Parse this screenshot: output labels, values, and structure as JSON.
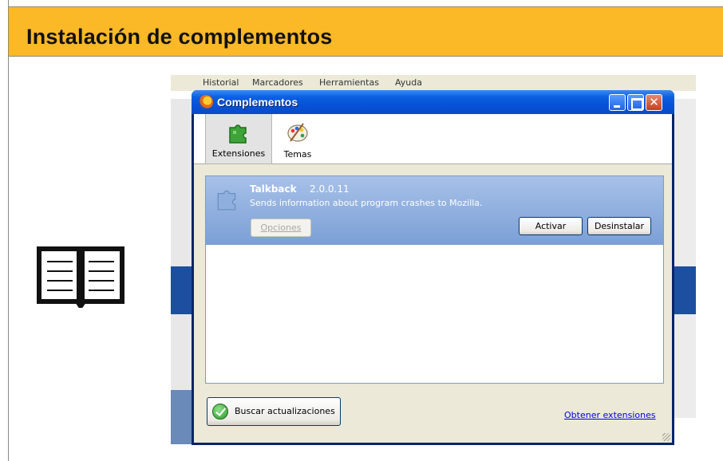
{
  "slide": {
    "title": "Instalación de complementos",
    "accent_color": "#fbb827",
    "icon": "open-book-icon"
  },
  "background_window": {
    "menu": [
      "Historial",
      "Marcadores",
      "Herramientas",
      "Ayuda"
    ]
  },
  "dialog": {
    "title": "Complementos",
    "title_icon": "firefox-icon",
    "controls": [
      "minimize-icon",
      "maximize-icon",
      "close-icon"
    ],
    "close_glyph": "✕",
    "toolbar": {
      "tabs": [
        {
          "label": "Extensiones",
          "icon": "puzzle-icon",
          "selected": true
        },
        {
          "label": "Temas",
          "icon": "palette-icon",
          "selected": false
        }
      ]
    },
    "extension": {
      "name": "Talkback",
      "version": "2.0.0.11",
      "description": "Sends information about program crashes to Mozilla.",
      "options_label": "Opciones",
      "activate_label": "Activar",
      "uninstall_label": "Desinstalar"
    },
    "footer": {
      "update_label": "Buscar actualizaciones",
      "get_extensions_label": "Obtener extensiones"
    }
  }
}
